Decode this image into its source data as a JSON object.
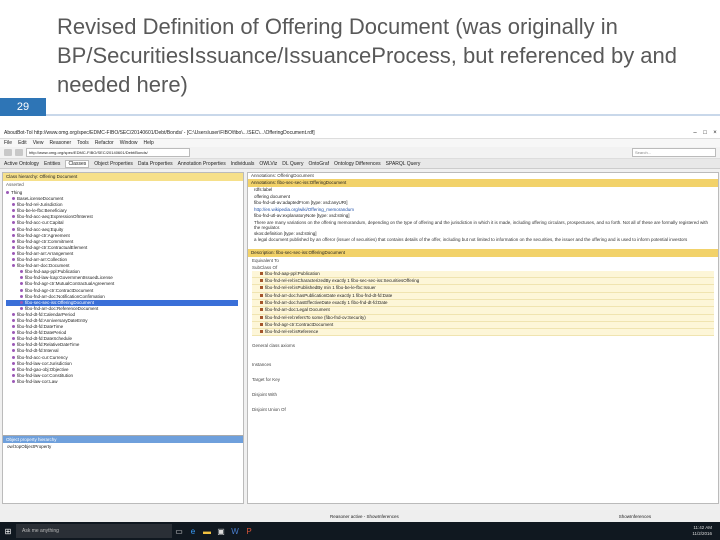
{
  "slide": {
    "title": "Revised Definition of Offering Document (was originally in BP/SecuritiesIssuance/IssuanceProcess, but referenced by and needed here)",
    "number": "29"
  },
  "app": {
    "window_title": "AboutBot-Tol http://www.omg.org/spec/EDMC-FIBO/SEC/20140601/Debt/Bonds/ - [C:\\Users\\user\\FIBO\\fibo\\...\\SEC\\...\\OfferingDocument.rdf]",
    "menu": [
      "File",
      "Edit",
      "View",
      "Reasoner",
      "Tools",
      "Refactor",
      "Window",
      "Help"
    ],
    "address": "http://www.omg.org/spec/EDMC-FIBO/SEC/20140601/Debt/Bonds/",
    "search_placeholder": "Search...",
    "tabs": [
      "Active Ontology",
      "Entities",
      "Classes",
      "Object Properties",
      "Data Properties",
      "Annotation Properties",
      "Individuals",
      "OWLViz",
      "DL Query",
      "OntoGraf",
      "Ontology Differences",
      "SPARQL Query"
    ],
    "active_tab": "Classes",
    "left_panel": {
      "header": "Class hierarchy: Offering Document",
      "sub": "Asserted",
      "tree": [
        "Thing",
        "BaseLicenseDocument",
        "fibo-fnd-rel-Jurisdiction",
        "fibo-be-le-fbc:Beneficiary",
        "fibo-fnd-acc-aeq:ExpressionOfInterest",
        "fibo-fnd-acc-cur:Capital",
        "fibo-fnd-acc-aeq:Equity",
        "fibo-fnd-agr-ctr:Agreement",
        "fibo-fnd-agr-ctr:Commitment",
        "fibo-fnd-agr-ctr:ContractualElement",
        "fibo-fnd-arr-arr:Arrangement",
        "fibo-fnd-arr-arr:Collection",
        "fibo-fnd-arr-doc:Document",
        "fibo-fnd-aap-ppl:Publication",
        "fibo-fnd-law-lcap:GovernmentIssuedLicense",
        "fibo-fnd-agr-ctr:MutualContractualAgreement",
        "fibo-fnd-agr-ctr:ContractDocument",
        "fibo-fnd-arr-doc:NotificationConfirmation",
        "fibo-sec-sec-iss:OfferingDocument",
        "fibo-fnd-arr-doc:ReferenceDocument",
        "fibo-fnd-dt-fd:CalendarPeriod",
        "fibo-fnd-dt-fd:AnniversaryDateEntry",
        "fibo-fnd-dt-fd:DateTime",
        "fibo-fnd-dt-fd:DatePeriod",
        "fibo-fnd-dt-fd:DateSchedule",
        "fibo-fnd-dt-fd:RelativeDateTime",
        "fibo-fnd-dt-fd:Interval",
        "fibo-fnd-acc-cur:Currency",
        "fibo-fnd-law-cor:Jurisdiction",
        "fibo-fnd-gao-obj:Objective",
        "fibo-fnd-law-cor:Constitution",
        "fibo-fnd-law-cor:Law"
      ],
      "selected_index": 18,
      "bottom_header": "Object property hierarchy",
      "bottom_item": "owl:topObjectProperty"
    },
    "right_panel": {
      "annotations_label": "Annotations: OfferingDocument",
      "section1": "Annotations: fibo-sec-sec-iss:OfferingDocument",
      "annotations": [
        {
          "text": "rdfs:label",
          "link": false
        },
        {
          "text": "offering document",
          "link": false
        },
        {
          "text": "fibo-fnd-utl-av:adaptedFrom [type: xsd:anyURI]",
          "link": false
        },
        {
          "text": "http://en.wikipedia.org/wiki/Offering_memorandum",
          "link": true
        },
        {
          "text": "fibo-fnd-utl-av:explanatoryNote [type: xsd:string]",
          "link": false
        }
      ],
      "note": "There are many variations on the offering memorandum, depending on the type of offering and the jurisdiction in which it is made, including offering circulars, prospectuses, and so forth. Not all of these are formally registered with the regulator.",
      "definition_label": "skos:definition [type: xsd:string]",
      "definition": "a legal document published by an offeror (issuer of securities) that contains details of the offer, including but not limited to information on the securities, the issuer and the offering and is used to inform potential investors",
      "section2": "Description: fibo-sec-sec-iss:OfferingDocument",
      "equivalent_label": "Equivalent To",
      "subclass_label": "SubClass Of",
      "subclass_rows": [
        "fibo-fnd-aap-ppl:Publication",
        "fibo-fnd-rel-rel:isCharacterizedBy exactly 1 fibo-sec-sec-iss:SecuritiesOffering",
        "fibo-fnd-rel-rel:isPublishedBy min 1 fibo-be-le-fbc:Issuer",
        "fibo-fnd-arr-doc:hasPublicationDate exactly 1 fibo-fnd-dt-fd:Date",
        "fibo-fnd-arr-doc:hasEffectiveDate exactly 1 fibo-fnd-dt-fd:Date",
        "fibo-fnd-arr-doc:Legal Document",
        "fibo-fnd-rel-rel:refersTo some (fibo-fnd-ov:Security)",
        "fibo-fnd-agr-ctr:ContractDocument",
        "fibo-fnd-rel-rel:isReference"
      ],
      "general_label": "General class axioms",
      "instances_label": "Instances",
      "target_label": "Target for Key",
      "disjoint_label": "Disjoint With",
      "disjoint_union_label": "Disjoint Union Of"
    },
    "status": {
      "left": "Reasoner active - ShowInferences",
      "right": "ShowInferences"
    }
  },
  "taskbar": {
    "search": "Ask me anything",
    "time": "11:42 AM",
    "date": "11/2/2016"
  }
}
